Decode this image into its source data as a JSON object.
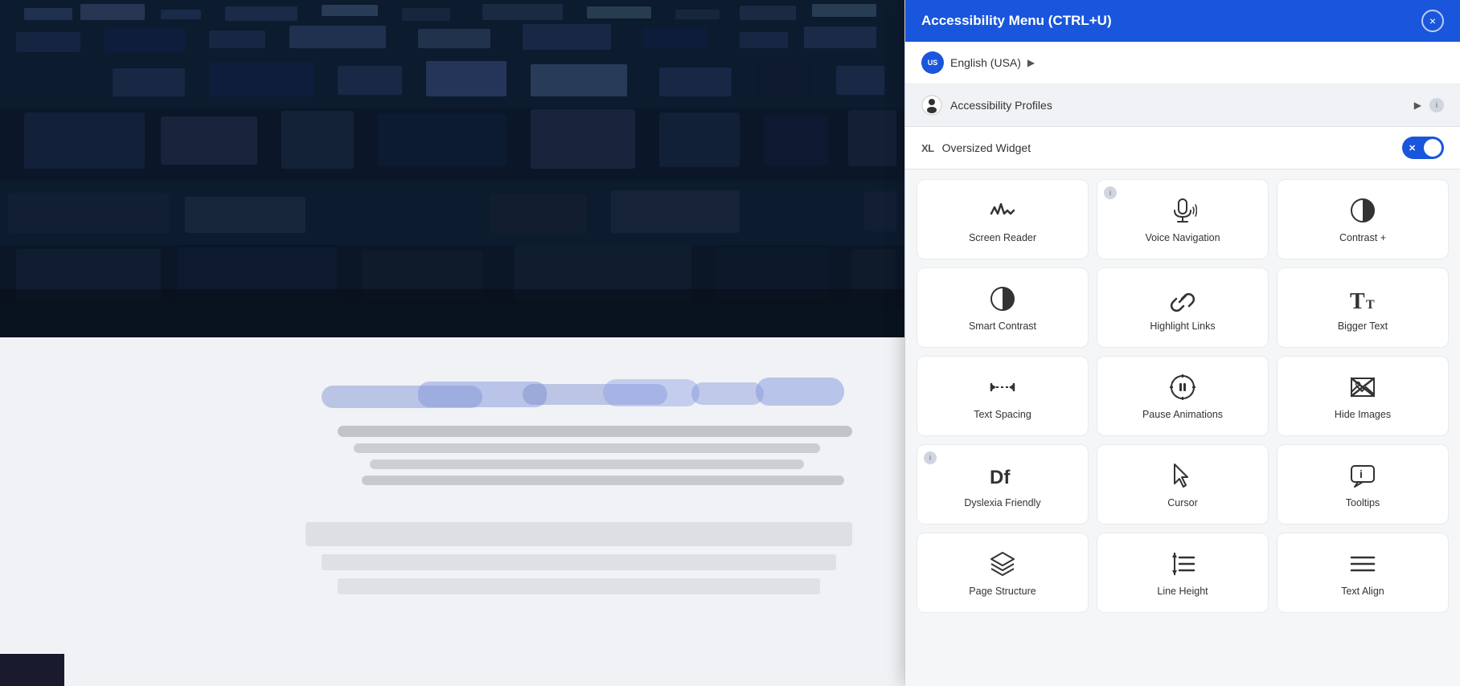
{
  "panel": {
    "title": "Accessibility Menu (CTRL+U)",
    "close_label": "×",
    "language": {
      "flag": "US",
      "text": "English (USA)",
      "arrow": "▶"
    },
    "profiles": {
      "text": "Accessibility Profiles",
      "arrow": "▶",
      "info": "i"
    },
    "oversized_widget": {
      "label": "XL",
      "text": "Oversized Widget",
      "toggle_x": "✕"
    },
    "features": [
      {
        "id": "screen-reader",
        "label": "Screen Reader",
        "icon_type": "waveform",
        "has_info": false
      },
      {
        "id": "voice-navigation",
        "label": "Voice Navigation",
        "icon_type": "mic-wave",
        "has_info": true
      },
      {
        "id": "contrast-plus",
        "label": "Contrast +",
        "icon_type": "half-circle",
        "has_info": false
      },
      {
        "id": "smart-contrast",
        "label": "Smart Contrast",
        "icon_type": "smart-contrast",
        "has_info": false
      },
      {
        "id": "highlight-links",
        "label": "Highlight Links",
        "icon_type": "chain",
        "has_info": false
      },
      {
        "id": "bigger-text",
        "label": "Bigger Text",
        "icon_type": "big-t",
        "has_info": false
      },
      {
        "id": "text-spacing",
        "label": "Text Spacing",
        "icon_type": "arrows",
        "has_info": false
      },
      {
        "id": "pause-animations",
        "label": "Pause Animations",
        "icon_type": "pause-circle",
        "has_info": false
      },
      {
        "id": "hide-images",
        "label": "Hide Images",
        "icon_type": "image-x",
        "has_info": false
      },
      {
        "id": "dyslexia-friendly",
        "label": "Dyslexia Friendly",
        "icon_type": "df",
        "has_info": true
      },
      {
        "id": "cursor",
        "label": "Cursor",
        "icon_type": "cursor",
        "has_info": false
      },
      {
        "id": "tooltips",
        "label": "Tooltips",
        "icon_type": "tooltip",
        "has_info": false
      },
      {
        "id": "page-structure",
        "label": "Page Structure",
        "icon_type": "layers",
        "has_info": false
      },
      {
        "id": "line-height",
        "label": "Line Height",
        "icon_type": "line-height",
        "has_info": false
      },
      {
        "id": "text-align",
        "label": "Text Align",
        "icon_type": "text-align",
        "has_info": false
      }
    ]
  }
}
